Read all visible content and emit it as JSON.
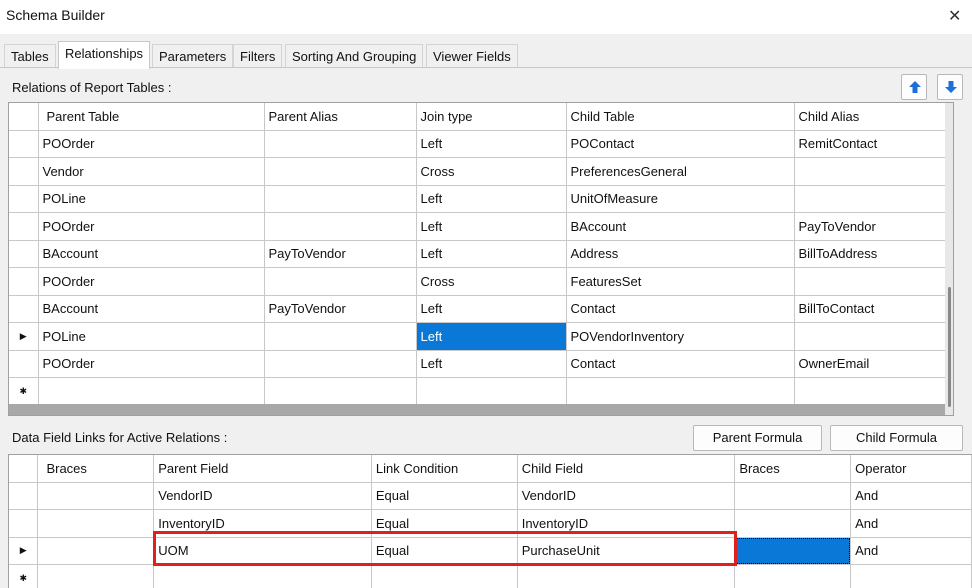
{
  "window": {
    "title": "Schema Builder",
    "close_glyph": "✕"
  },
  "tabs": [
    {
      "label": "Tables"
    },
    {
      "label": "Relationships"
    },
    {
      "label": "Parameters"
    },
    {
      "label": "Filters"
    },
    {
      "label": "Sorting And Grouping"
    },
    {
      "label": "Viewer Fields"
    }
  ],
  "active_tab": "Relationships",
  "relations": {
    "label": "Relations of Report Tables :",
    "move_up_icon": "arrow-up-icon",
    "move_down_icon": "arrow-down-icon",
    "columns": [
      "Parent Table",
      "Parent Alias",
      "Join type",
      "Child Table",
      "Child Alias"
    ],
    "rows": [
      [
        "POOrder",
        "",
        "Left",
        "POContact",
        "RemitContact"
      ],
      [
        "Vendor",
        "",
        "Cross",
        "PreferencesGeneral",
        ""
      ],
      [
        "POLine",
        "",
        "Left",
        "UnitOfMeasure",
        ""
      ],
      [
        "POOrder",
        "",
        "Left",
        "BAccount",
        "PayToVendor"
      ],
      [
        "BAccount",
        "PayToVendor",
        "Left",
        "Address",
        "BillToAddress"
      ],
      [
        "POOrder",
        "",
        "Cross",
        "FeaturesSet",
        ""
      ],
      [
        "BAccount",
        "PayToVendor",
        "Left",
        "Contact",
        "BillToContact"
      ],
      [
        "POLine",
        "",
        "Left",
        "POVendorInventory",
        ""
      ],
      [
        "POOrder",
        "",
        "Left",
        "Contact",
        "OwnerEmail"
      ]
    ],
    "current_row_marker": "▶",
    "new_row_marker": "✱"
  },
  "links": {
    "label": "Data Field Links for Active Relations :",
    "parent_formula_label": "Parent Formula",
    "child_formula_label": "Child Formula",
    "columns": [
      "Braces",
      "Parent Field",
      "Link Condition",
      "Child Field",
      "Braces",
      "Operator"
    ],
    "rows": [
      [
        "",
        "VendorID",
        "Equal",
        "VendorID",
        "",
        "And"
      ],
      [
        "",
        "InventoryID",
        "Equal",
        "InventoryID",
        "",
        "And"
      ],
      [
        "",
        "UOM",
        "Equal",
        "PurchaseUnit",
        "",
        "And"
      ]
    ],
    "current_row_marker": "▶",
    "new_row_marker": "✱"
  },
  "colors": {
    "selection": "#0a78d7",
    "highlight_box": "#e0201c"
  }
}
